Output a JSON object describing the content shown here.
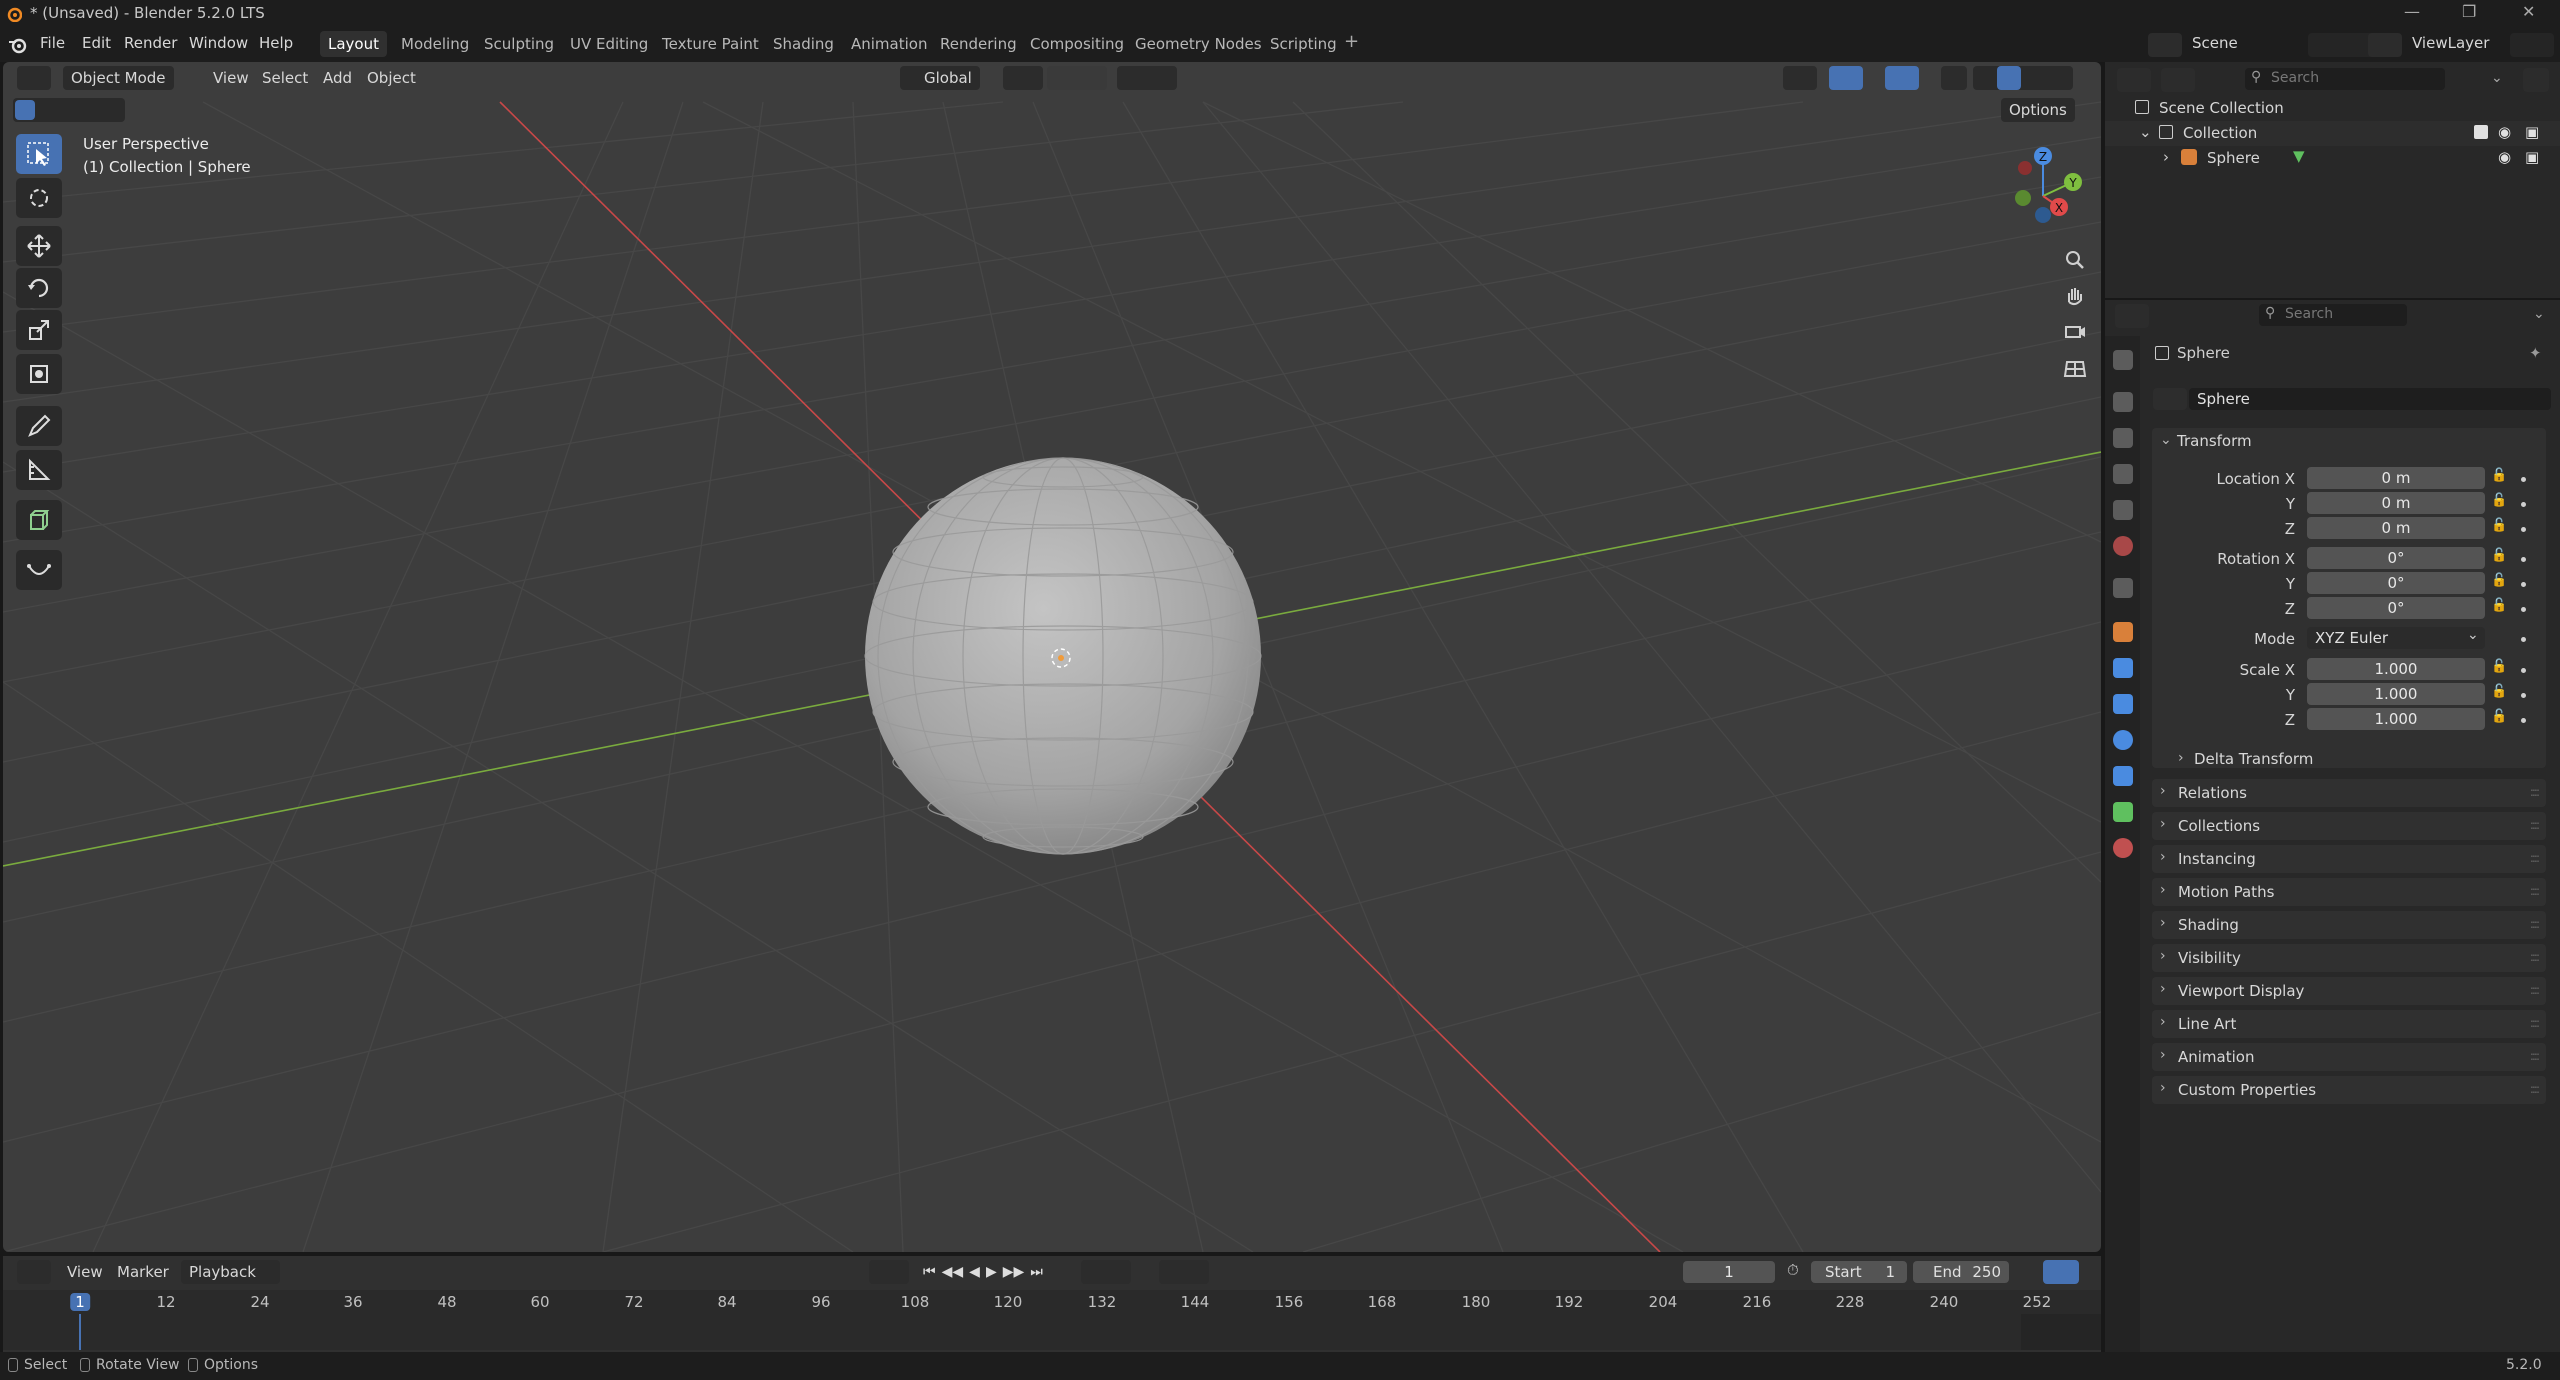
{
  "window": {
    "title": "* (Unsaved) - Blender 5.2.0 LTS"
  },
  "menu": [
    "File",
    "Edit",
    "Render",
    "Window",
    "Help"
  ],
  "workspaces": [
    "Layout",
    "Modeling",
    "Sculpting",
    "UV Editing",
    "Texture Paint",
    "Shading",
    "Animation",
    "Rendering",
    "Compositing",
    "Geometry Nodes",
    "Scripting"
  ],
  "active_workspace": "Layout",
  "scene": {
    "name": "Scene",
    "view_layer": "ViewLayer"
  },
  "viewport": {
    "mode": "Object Mode",
    "menus": [
      "View",
      "Select",
      "Add",
      "Object"
    ],
    "orientation": "Global",
    "options_label": "Options",
    "overlay_text_1": "User Perspective",
    "overlay_text_2": "(1) Collection | Sphere",
    "gizmo": {
      "z": "Z",
      "y": "Y",
      "x": "X"
    }
  },
  "outliner": {
    "search_placeholder": "Search",
    "items": [
      "Scene Collection",
      "Collection",
      "Sphere"
    ]
  },
  "properties": {
    "search_placeholder": "Search",
    "object_name": "Sphere",
    "data_name": "Sphere",
    "transform_label": "Transform",
    "location": {
      "label": "Location X",
      "x": "0 m",
      "y": "0 m",
      "z": "0 m"
    },
    "rotation": {
      "label": "Rotation X",
      "x": "0°",
      "y": "0°",
      "z": "0°"
    },
    "mode": {
      "label": "Mode",
      "value": "XYZ Euler"
    },
    "scale": {
      "label": "Scale X",
      "x": "1.000",
      "y": "1.000",
      "z": "1.000"
    },
    "axis_y": "Y",
    "axis_z": "Z",
    "delta_transform": "Delta Transform",
    "panels": [
      "Relations",
      "Collections",
      "Instancing",
      "Motion Paths",
      "Shading",
      "Visibility",
      "Viewport Display",
      "Line Art",
      "Animation",
      "Custom Properties"
    ]
  },
  "timeline": {
    "menus": [
      "View",
      "Marker",
      "Playback"
    ],
    "current_frame": "1",
    "start_label": "Start",
    "start": "1",
    "end_label": "End",
    "end": "250",
    "ticks": [
      "1",
      "12",
      "24",
      "36",
      "48",
      "60",
      "72",
      "84",
      "96",
      "108",
      "120",
      "132",
      "144",
      "156",
      "168",
      "180",
      "192",
      "204",
      "216",
      "228",
      "240",
      "252"
    ]
  },
  "status": {
    "select": "Select",
    "rotate": "Rotate View",
    "options": "Options",
    "version": "5.2.0"
  },
  "colors": {
    "accent": "#4772b3",
    "x_axis": "#e04a4a",
    "y_axis": "#7fbf3f",
    "z_axis": "#4a8be0"
  }
}
